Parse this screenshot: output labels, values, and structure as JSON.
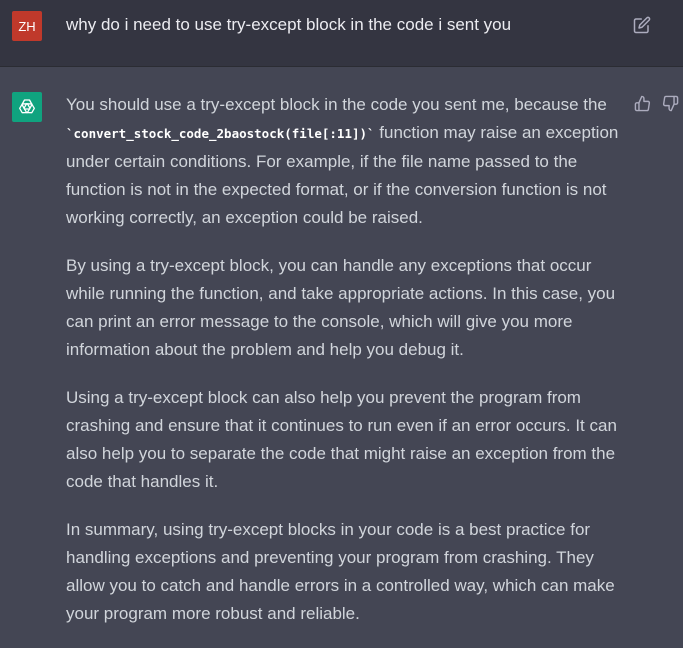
{
  "user_message": {
    "avatar_initials": "ZH",
    "avatar_color": "#c0392b",
    "text": "why do i need to use try-except block in the code i sent you",
    "edit_icon": "edit-icon"
  },
  "assistant_message": {
    "avatar_icon": "openai-logo-icon",
    "avatar_color": "#10a37f",
    "feedback_icons": [
      "thumbs-up-icon",
      "thumbs-down-icon"
    ],
    "paragraph_1_before": "You should use a try-except block in the code you sent me, because the ",
    "paragraph_1_code": "`convert_stock_code_2baostock(file[:11])`",
    "paragraph_1_after": " function may raise an exception under certain conditions. For example, if the file name passed to the function is not in the expected format, or if the conversion function is not working correctly, an exception could be raised.",
    "paragraph_2": "By using a try-except block, you can handle any exceptions that occur while running the function, and take appropriate actions. In this case, you can print an error message to the console, which will give you more information about the problem and help you debug it.",
    "paragraph_3": "Using a try-except block can also help you prevent the program from crashing and ensure that it continues to run even if an error occurs. It can also help you to separate the code that might raise an exception from the code that handles it.",
    "paragraph_4": "In summary, using try-except blocks in your code is a best practice for handling exceptions and preventing your program from crashing. They allow you to catch and handle errors in a controlled way, which can make your program more robust and reliable."
  }
}
